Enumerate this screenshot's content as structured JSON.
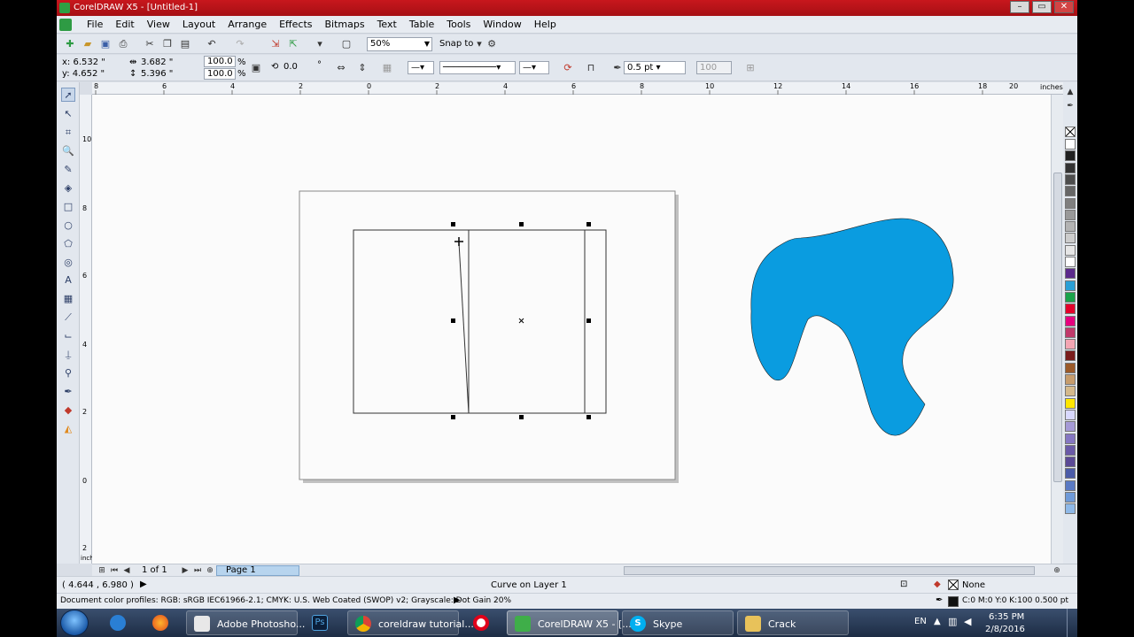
{
  "window": {
    "title": "CorelDRAW X5 - [Untitled-1]",
    "min_label": "–",
    "max_label": "▭",
    "close_label": "✕"
  },
  "menu": [
    "File",
    "Edit",
    "View",
    "Layout",
    "Arrange",
    "Effects",
    "Bitmaps",
    "Text",
    "Table",
    "Tools",
    "Window",
    "Help"
  ],
  "toolbar": {
    "zoom": "50%",
    "snap": "Snap to"
  },
  "properties": {
    "x": "x: 6.532 \"",
    "y": "y: 4.652 \"",
    "w": "3.682 \"",
    "h": "5.396 \"",
    "sx": "100.0",
    "sy": "100.0",
    "pct": "%",
    "rotation": "0.0",
    "degree": "°",
    "outline_width": "0.5 pt",
    "smooth": "100"
  },
  "ruler": {
    "unit": "inches",
    "h_ticks": [
      "8",
      "6",
      "4",
      "2",
      "0",
      "2",
      "4",
      "6",
      "8",
      "10",
      "12",
      "14",
      "16",
      "18",
      "20"
    ],
    "v_ticks": [
      "10",
      "8",
      "6",
      "4",
      "2",
      "0",
      "2"
    ],
    "v_unit": "inches"
  },
  "pages": {
    "count": "1 of 1",
    "tab": "Page 1"
  },
  "status": {
    "coords": "( 4.644 , 6.980 )",
    "selection": "Curve on Layer 1",
    "fill": "None",
    "profiles": "Document color profiles: RGB: sRGB IEC61966-2.1; CMYK: U.S. Web Coated (SWOP) v2; Grayscale: Dot Gain 20%",
    "outline": "C:0 M:0 Y:0 K:100  0.500 pt"
  },
  "colors": {
    "blob": "#0a9ce0",
    "title": "#b3131a"
  },
  "palette": [
    "#ffffff",
    "#202020",
    "#333333",
    "#4d4d4d",
    "#666666",
    "#7f7f7f",
    "#999999",
    "#b3b3b3",
    "#cccccc",
    "#e6e6e6",
    "#ffffff",
    "#5b2a8c",
    "#2a9fd6",
    "#1aa34a",
    "#e4002b",
    "#e6007e",
    "#c03a6b",
    "#f3a6b3",
    "#7a1d1d",
    "#9b5a2a",
    "#c69c6d",
    "#d4b98c",
    "#ffe600",
    "#d9d9ff",
    "#a59ad6",
    "#8577c2",
    "#6a5aa8",
    "#5b4a96",
    "#4a5ba8",
    "#5a7ac4",
    "#6f9ad8",
    "#8fb9e8"
  ],
  "taskbar": {
    "items": [
      {
        "label": "Adobe Photosho..."
      },
      {
        "label": ""
      },
      {
        "label": "coreldraw tutorial..."
      },
      {
        "label": ""
      },
      {
        "label": "CorelDRAW X5 - [..."
      },
      {
        "label": "Skype"
      },
      {
        "label": "Crack"
      }
    ],
    "lang": "EN",
    "time": "6:35 PM",
    "date": "2/8/2016"
  }
}
